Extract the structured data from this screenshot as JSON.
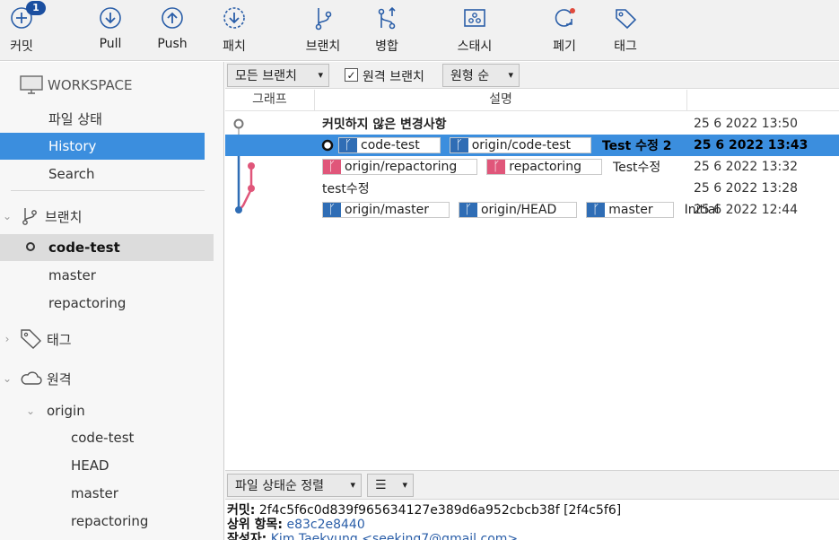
{
  "toolbar": {
    "commit": {
      "label": "커밋",
      "badge": "1"
    },
    "pull": {
      "label": "Pull"
    },
    "push": {
      "label": "Push"
    },
    "patch": {
      "label": "패치"
    },
    "branch": {
      "label": "브랜치"
    },
    "merge": {
      "label": "병합"
    },
    "stash": {
      "label": "스태시"
    },
    "discard": {
      "label": "폐기"
    },
    "tag": {
      "label": "태그"
    }
  },
  "sidebar": {
    "workspace": {
      "label": "WORKSPACE",
      "items": [
        "파일 상태",
        "History",
        "Search"
      ],
      "selected": "History"
    },
    "branches": {
      "label": "브랜치",
      "items": [
        "code-test",
        "master",
        "repactoring"
      ],
      "current": "code-test"
    },
    "tags": {
      "label": "태그"
    },
    "remotes": {
      "label": "원격",
      "origin": {
        "label": "origin",
        "items": [
          "code-test",
          "HEAD",
          "master",
          "repactoring"
        ]
      }
    }
  },
  "filters": {
    "branch_select": "모든 브랜치",
    "remote_checkbox": {
      "label": "원격 브랜치",
      "checked": true
    },
    "order_select": "원형 순"
  },
  "columns": {
    "graph": "그래프",
    "description": "설명"
  },
  "commits": [
    {
      "text": "커밋하지 않은 변경사항",
      "date": "25 6 2022 13:50",
      "tags": []
    },
    {
      "text": "Test 수정 2",
      "date": "25 6 2022 13:43",
      "tags": [
        {
          "name": "code-test",
          "color": "#2f6db5"
        },
        {
          "name": "origin/code-test",
          "color": "#2f6db5"
        }
      ]
    },
    {
      "text": "Test수정",
      "date": "25 6 2022 13:32",
      "tags": [
        {
          "name": "origin/repactoring",
          "color": "#e0567a"
        },
        {
          "name": "repactoring",
          "color": "#e0567a"
        }
      ]
    },
    {
      "text": "test수정",
      "date": "25 6 2022 13:28",
      "tags": []
    },
    {
      "text": "Initial",
      "date": "25 6 2022 12:44",
      "tags": [
        {
          "name": "origin/master",
          "color": "#2f6db5"
        },
        {
          "name": "origin/HEAD",
          "color": "#2f6db5"
        },
        {
          "name": "master",
          "color": "#2f6db5"
        }
      ]
    }
  ],
  "bottom": {
    "sort_select": "파일 상태순 정렬",
    "view_select": "☰",
    "commit_label": "커밋:",
    "commit_value": "2f4c5f6c0d839f965634127e389d6a952cbcb38f [2f4c5f6]",
    "parent_label": "상위 항목:",
    "parent_value": "e83c2e8440",
    "author_label": "작성자:",
    "author_value": "Kim Taekyung <seeking7@gmail.com>"
  },
  "colors": {
    "selection": "#3b8ede",
    "branch_blue": "#2f6db5",
    "branch_pink": "#e0567a",
    "badge": "#1b4fa0"
  }
}
